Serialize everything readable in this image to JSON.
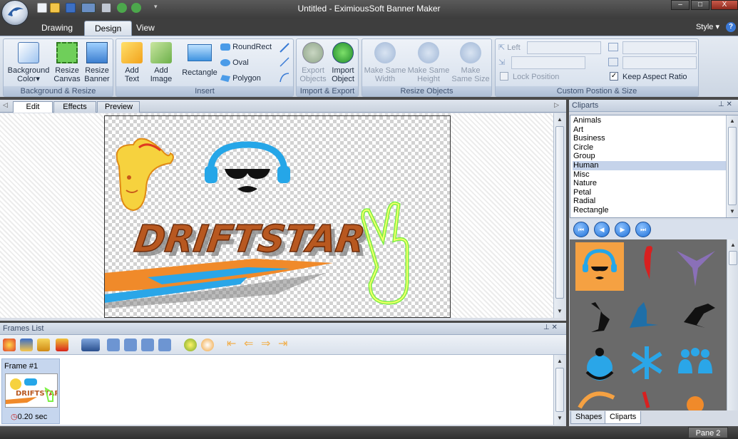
{
  "window": {
    "title": "Untitled - EximiousSoft Banner Maker",
    "min": "–",
    "max": "□",
    "close": "X"
  },
  "ribbon_tabs": [
    "Drawing",
    "Design",
    "View"
  ],
  "style_menu": "Style",
  "help": "?",
  "groups": {
    "background_resize": {
      "caption": "Background & Resize",
      "bg_color_l1": "Background",
      "bg_color_l2": "Color",
      "resize_canvas_l1": "Resize",
      "resize_canvas_l2": "Canvas",
      "resize_banner_l1": "Resize",
      "resize_banner_l2": "Banner"
    },
    "insert": {
      "caption": "Insert",
      "add_text_l1": "Add",
      "add_text_l2": "Text",
      "add_image_l1": "Add",
      "add_image_l2": "Image",
      "rectangle": "Rectangle",
      "roundrect": "RoundRect",
      "oval": "Oval",
      "polygon": "Polygon"
    },
    "import_export": {
      "caption": "Import & Export",
      "export_l1": "Export",
      "export_l2": "Objects",
      "import_l1": "Import",
      "import_l2": "Object"
    },
    "resize_objects": {
      "caption": "Resize Objects",
      "same_width_l1": "Make Same",
      "same_width_l2": "Width",
      "same_height_l1": "Make Same",
      "same_height_l2": "Height",
      "same_size_l1": "Make",
      "same_size_l2": "Same Size"
    },
    "custom_pos": {
      "caption": "Custom Postion & Size",
      "left": "Left",
      "lock": "Lock Position",
      "keep_aspect": "Keep Aspect Ratio"
    }
  },
  "doc_tabs": [
    "Edit",
    "Effects",
    "Preview"
  ],
  "banner_text": "DRIFTSTAR",
  "frames": {
    "title": "Frames List",
    "frame_label": "Frame #1",
    "duration": "0.20 sec",
    "mini_text": "DRIFTSTAR"
  },
  "cliparts": {
    "title": "Cliparts",
    "categories": [
      "Animals",
      "Art",
      "Business",
      "Circle",
      "Group",
      "Human",
      "Misc",
      "Nature",
      "Petal",
      "Radial",
      "Rectangle"
    ],
    "selected": "Human",
    "tabs": [
      "Shapes",
      "Cliparts"
    ]
  },
  "status": {
    "pane": "Pane 2"
  },
  "colors": {
    "accent": "#3b79d6",
    "ribbon": "#dbe3ee",
    "selected_cat": "#c5d3ea",
    "dark_frame": "#3e3e3e"
  }
}
